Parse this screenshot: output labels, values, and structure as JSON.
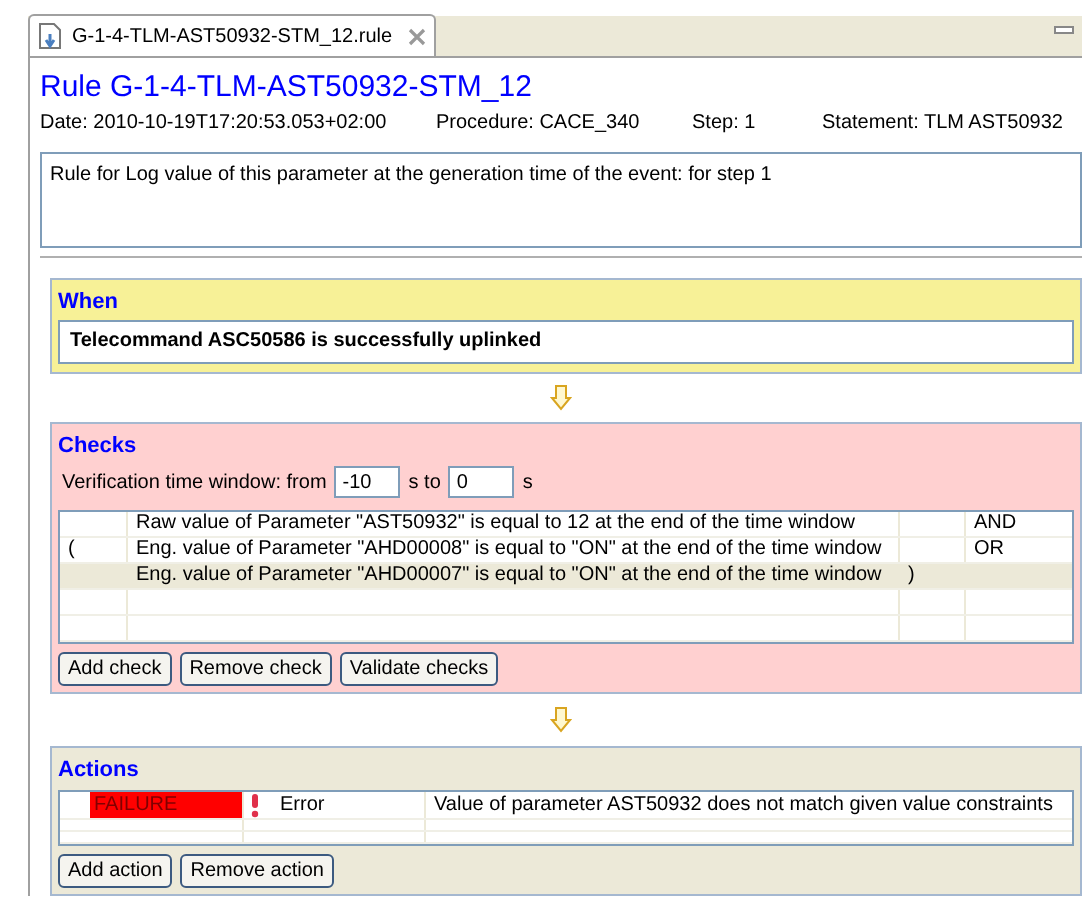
{
  "editor_tab": {
    "label": "G-1-4-TLM-AST50932-STM_12.rule",
    "selected": true
  },
  "title": "Rule G-1-4-TLM-AST50932-STM_12",
  "info": [
    "Date: 2010-10-19T17:20:53.053+02:00",
    "Procedure: CACE_340",
    "Step: 1",
    "Statement: TLM AST50932"
  ],
  "description": "Rule for Log value of this parameter at the generation time of the event: for step 1",
  "when": {
    "heading": "When",
    "condition": "Telecommand ASC50586 is successfully uplinked"
  },
  "checks": {
    "heading": "Checks",
    "window_label": "Verification time window: from",
    "from": "-10",
    "to_label": "s to",
    "to": "0",
    "unit": "s",
    "rows": [
      {
        "open": "",
        "condition": "Raw value of Parameter \"AST50932\" is equal to 12  at the end of the time window",
        "close": "",
        "operator": "AND",
        "selected": false
      },
      {
        "open": "(",
        "condition": "Eng. value of Parameter \"AHD00008\" is equal to \"ON\"  at the end of the time window",
        "close": "",
        "operator": "OR",
        "selected": false
      },
      {
        "open": "",
        "condition": "Eng. value of Parameter \"AHD00007\" is equal to \"ON\"  at the end of the time window",
        "close": ")",
        "operator": "",
        "selected": true
      }
    ],
    "buttons": [
      "Add check",
      "Remove check",
      "Validate checks"
    ]
  },
  "actions": {
    "heading": "Actions",
    "rows": [
      {
        "status": "FAILURE",
        "color": "#ff0000",
        "severity": "Error",
        "message": "Value of parameter AST50932 does not match given value constraints"
      }
    ],
    "buttons": [
      "Add action",
      "Remove action"
    ]
  }
}
